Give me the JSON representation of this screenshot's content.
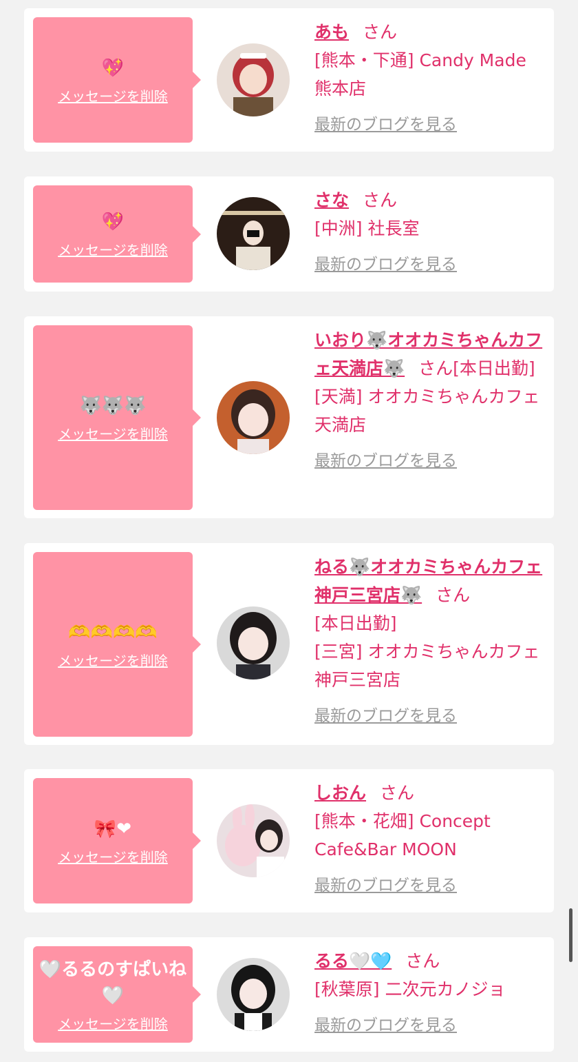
{
  "messages": [
    {
      "message": "💖",
      "delete_label": "メッセージを削除",
      "name": "あも",
      "honorific": "さん",
      "shop": "[熊本・下通] Candy Made 熊本店",
      "blog_label": "最新のブログを見る",
      "avatar_icon": "avatar-red-hair-maid-photo"
    },
    {
      "message": "💖",
      "delete_label": "メッセージを削除",
      "name": "さな",
      "honorific": "さん",
      "shop": "[中洲] 社長室",
      "blog_label": "最新のブログを見る",
      "avatar_icon": "avatar-office-photo"
    },
    {
      "message": "🐺🐺🐺",
      "delete_label": "メッセージを削除",
      "name": "いおり🐺オオカミちゃんカフェ天満店🐺",
      "honorific": "さん[本日出勤]",
      "shop": "[天満] オオカミちゃんカフェ天満店",
      "blog_label": "最新のブログを見る",
      "avatar_icon": "avatar-girl-photo"
    },
    {
      "message": "🫶🫶🫶🫶",
      "delete_label": "メッセージを削除",
      "name": "ねる🐺オオカミちゃんカフェ神戸三宮店🐺",
      "honorific": "さん",
      "status": "[本日出勤]",
      "shop": "[三宮] オオカミちゃんカフェ神戸三宮店",
      "blog_label": "最新のブログを見る",
      "avatar_icon": "avatar-girl-photo"
    },
    {
      "message": "🎀❤",
      "delete_label": "メッセージを削除",
      "name": "しおん",
      "honorific": "さん",
      "shop": "[熊本・花畑] Concept Cafe&Bar MOON",
      "blog_label": "最新のブログを見る",
      "avatar_icon": "avatar-bunny-plush-photo"
    },
    {
      "message": "🤍るるのすぱいね🤍",
      "delete_label": "メッセージを削除",
      "name": "るる🤍🩵",
      "honorific": "さん",
      "shop": "[秋葉原] 二次元カノジョ",
      "blog_label": "最新のブログを見る",
      "avatar_icon": "avatar-maid-photo"
    }
  ],
  "colors": {
    "accent": "#e0306a",
    "bubble": "#ff93a5",
    "card": "#ffffff",
    "background": "#f2f2f2",
    "muted_link": "#9a9a9a"
  }
}
